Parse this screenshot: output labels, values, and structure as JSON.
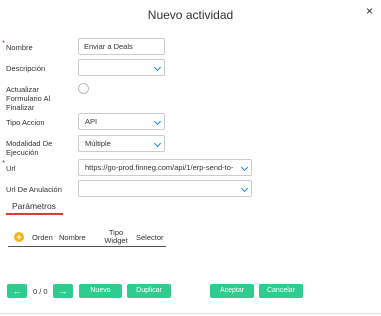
{
  "dialog": {
    "title": "Nuevo actividad",
    "close_glyph": "×"
  },
  "form": {
    "nombre": {
      "label": "Nombre",
      "value": "Enviar a Deals",
      "required": true
    },
    "descripcion": {
      "label": "Descripción",
      "value": ""
    },
    "actualizar": {
      "label_lines": [
        "Actualizar",
        "Formulario Al",
        "Finalizar"
      ]
    },
    "tipo_accion": {
      "label": "Tipo Accion",
      "value": "API"
    },
    "modalidad": {
      "label_lines": [
        "Modalidad De",
        "Ejecución"
      ],
      "value": "Múltiple"
    },
    "url": {
      "label": "Url",
      "value": "https://go-prod.finneg.com/api/1/erp-send-to-",
      "required": true
    },
    "url_anulacion": {
      "label": "Url De Anulación",
      "value": ""
    },
    "required_mark": "*"
  },
  "tabs": {
    "parametros": "Parámetros"
  },
  "grid": {
    "add_glyph": "+",
    "columns": {
      "orden": "Orden",
      "nombre": "Nombre",
      "tipo_widget_lines": [
        "Tipo",
        "Widget"
      ],
      "selector": "Selector"
    }
  },
  "footer": {
    "prev_glyph": "←",
    "next_glyph": "→",
    "pager": "0 / 0",
    "nuevo": "Nuevo",
    "duplicar": "Duplicar",
    "aceptar": "Aceptar",
    "cancelar": "Cancelar"
  },
  "colors": {
    "accent_green": "#2ecc8f",
    "required_red": "#e53935",
    "chevron_blue": "#1e88e5",
    "add_icon_yellow": "#f5b31b"
  }
}
